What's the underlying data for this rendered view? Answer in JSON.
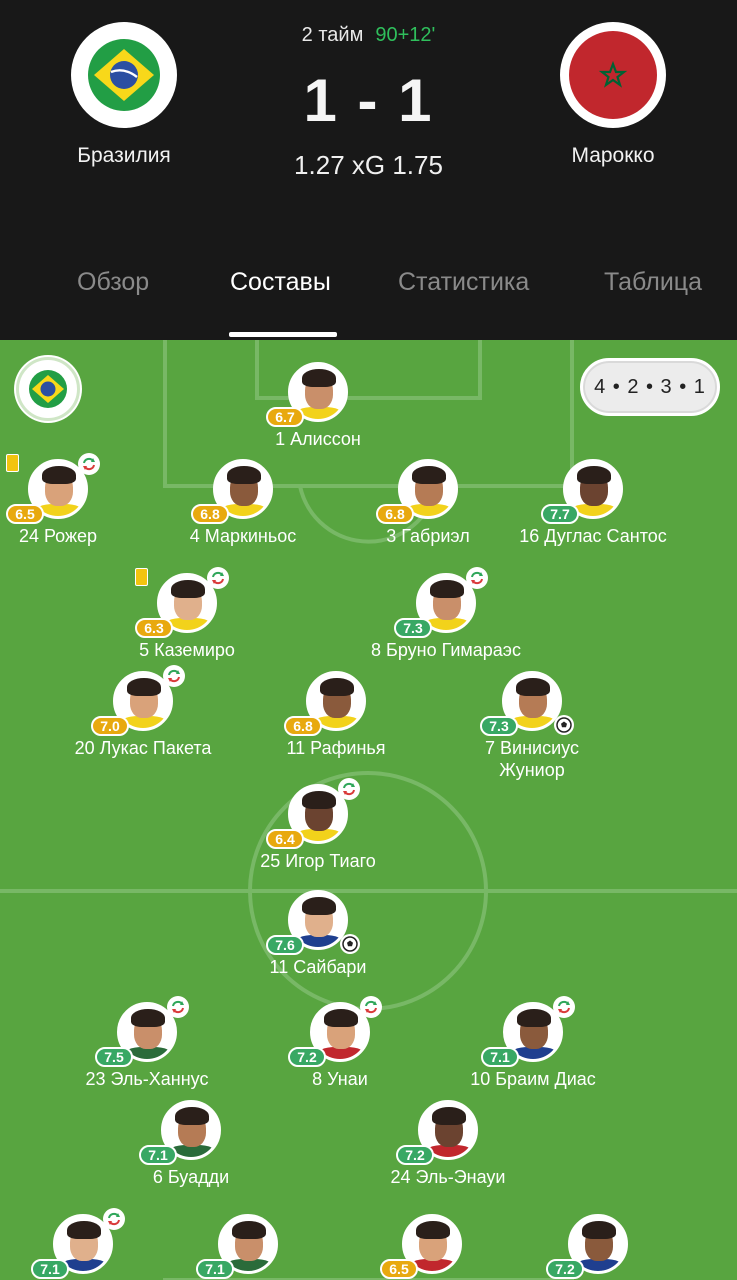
{
  "match": {
    "home_team": "Бразилия",
    "away_team": "Марокко",
    "period": "2 тайм",
    "time": "90+12'",
    "score": "1 - 1",
    "xg": "1.27 xG 1.75"
  },
  "tabs": [
    "Обзор",
    "Составы",
    "Статистика",
    "Таблица"
  ],
  "active_tab": "Составы",
  "formation": "4 • 2 • 3 • 1",
  "colors": {
    "rating_high": "#38a864",
    "rating_mid": "#e8a90f",
    "pitch": "#58a540",
    "accent_time": "#2fbf5c"
  },
  "players": [
    {
      "name": "1 Алиссон",
      "rating": "6.7",
      "tone": "y"
    },
    {
      "name": "24 Рожер",
      "rating": "6.5",
      "tone": "y",
      "card": "yellow",
      "sub": true
    },
    {
      "name": "4 Маркиньос",
      "rating": "6.8",
      "tone": "y"
    },
    {
      "name": "3 Габриэл",
      "rating": "6.8",
      "tone": "y"
    },
    {
      "name": "16 Дуглас Сантос",
      "rating": "7.7",
      "tone": "g"
    },
    {
      "name": "5 Каземиро",
      "rating": "6.3",
      "tone": "y",
      "card": "yellow",
      "sub": true
    },
    {
      "name": "8 Бруно Гимараэс",
      "rating": "7.3",
      "tone": "g",
      "sub": true
    },
    {
      "name": "20 Лукас Пакета",
      "rating": "7.0",
      "tone": "y",
      "sub": true
    },
    {
      "name": "11 Рафинья",
      "rating": "6.8",
      "tone": "y"
    },
    {
      "name": "7 Винисиус Жуниор",
      "rating": "7.3",
      "tone": "g",
      "goal": true
    },
    {
      "name": "25 Игор Тиаго",
      "rating": "6.4",
      "tone": "y",
      "sub": true
    },
    {
      "name": "11 Сайбари",
      "rating": "7.6",
      "tone": "g",
      "goal": true
    },
    {
      "name": "23 Эль-Ханнус",
      "rating": "7.5",
      "tone": "g",
      "sub": true
    },
    {
      "name": "8 Унаи",
      "rating": "7.2",
      "tone": "g",
      "sub": true
    },
    {
      "name": "10 Браим Диас",
      "rating": "7.1",
      "tone": "g",
      "sub": true
    },
    {
      "name": "6 Буадди",
      "rating": "7.1",
      "tone": "g"
    },
    {
      "name": "24 Эль-Энауи",
      "rating": "7.2",
      "tone": "g"
    },
    {
      "name": "",
      "rating": "7.1",
      "tone": "g",
      "sub": true
    },
    {
      "name": "",
      "rating": "7.1",
      "tone": "g"
    },
    {
      "name": "",
      "rating": "6.5",
      "tone": "y"
    },
    {
      "name": "",
      "rating": "7.2",
      "tone": "g"
    }
  ]
}
